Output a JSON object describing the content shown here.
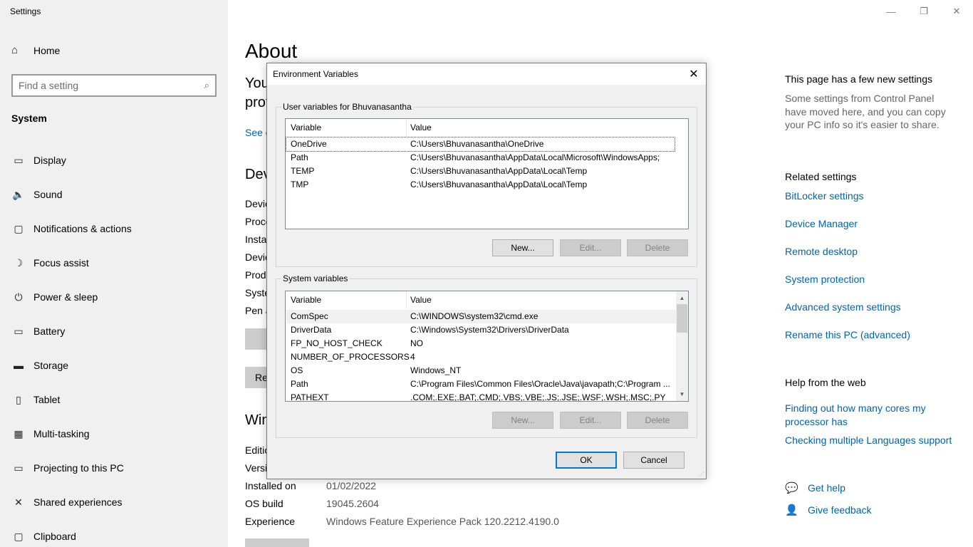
{
  "window": {
    "title": "Settings",
    "minimize": "—",
    "restore": "❐",
    "close": "✕"
  },
  "sidebar": {
    "home": "Home",
    "search_placeholder": "Find a setting",
    "section": "System",
    "items": [
      {
        "label": "Display",
        "icon": "display-icon",
        "glyph": "▭"
      },
      {
        "label": "Sound",
        "icon": "sound-icon",
        "glyph": "🔈"
      },
      {
        "label": "Notifications & actions",
        "icon": "notifications-icon",
        "glyph": "▢"
      },
      {
        "label": "Focus assist",
        "icon": "moon-icon",
        "glyph": "☽"
      },
      {
        "label": "Power & sleep",
        "icon": "power-icon",
        "glyph": "⏻"
      },
      {
        "label": "Battery",
        "icon": "battery-icon",
        "glyph": "▭"
      },
      {
        "label": "Storage",
        "icon": "storage-icon",
        "glyph": "▬"
      },
      {
        "label": "Tablet",
        "icon": "tablet-icon",
        "glyph": "▯"
      },
      {
        "label": "Multi-tasking",
        "icon": "multitasking-icon",
        "glyph": "▦"
      },
      {
        "label": "Projecting to this PC",
        "icon": "projecting-icon",
        "glyph": "▭"
      },
      {
        "label": "Shared experiences",
        "icon": "shared-icon",
        "glyph": "✕"
      },
      {
        "label": "Clipboard",
        "icon": "clipboard-icon",
        "glyph": "▢"
      }
    ]
  },
  "main": {
    "title": "About",
    "fragments": {
      "you": "You",
      "pro": "prot",
      "see": "See d",
      "dev": "Dev",
      "devi": "Devic",
      "proc": "Proce",
      "inst": "Instal",
      "devi2": "Devic",
      "prod": "Produ",
      "syst": "Syste",
      "pen": "Pen a",
      "re": "Re",
      "win": "Win",
      "edit": "Editio",
      "vers": "Versi"
    },
    "specs": [
      {
        "key": "Installed on",
        "value": "01/02/2022"
      },
      {
        "key": "OS build",
        "value": "19045.2604"
      },
      {
        "key": "Experience",
        "value": "Windows Feature Experience Pack 120.2212.4190.0"
      }
    ]
  },
  "right": {
    "new_settings_title": "This page has a few new settings",
    "new_settings_desc": "Some settings from Control Panel have moved here, and you can copy your PC info so it's easier to share.",
    "related_title": "Related settings",
    "related_links": [
      "BitLocker settings",
      "Device Manager",
      "Remote desktop",
      "System protection",
      "Advanced system settings",
      "Rename this PC (advanced)"
    ],
    "web_title": "Help from the web",
    "web_links": [
      "Finding out how many cores my processor has",
      "Checking multiple Languages support"
    ],
    "get_help": "Get help",
    "give_feedback": "Give feedback"
  },
  "dialog": {
    "title": "Environment Variables",
    "close": "✕",
    "user_group": "User variables for Bhuvanasantha",
    "system_group": "System variables",
    "col_variable": "Variable",
    "col_value": "Value",
    "user_vars": [
      {
        "name": "OneDrive",
        "value": "C:\\Users\\Bhuvanasantha\\OneDrive"
      },
      {
        "name": "Path",
        "value": "C:\\Users\\Bhuvanasantha\\AppData\\Local\\Microsoft\\WindowsApps;"
      },
      {
        "name": "TEMP",
        "value": "C:\\Users\\Bhuvanasantha\\AppData\\Local\\Temp"
      },
      {
        "name": "TMP",
        "value": "C:\\Users\\Bhuvanasantha\\AppData\\Local\\Temp"
      }
    ],
    "system_vars": [
      {
        "name": "ComSpec",
        "value": "C:\\WINDOWS\\system32\\cmd.exe"
      },
      {
        "name": "DriverData",
        "value": "C:\\Windows\\System32\\Drivers\\DriverData"
      },
      {
        "name": "FP_NO_HOST_CHECK",
        "value": "NO"
      },
      {
        "name": "NUMBER_OF_PROCESSORS",
        "value": "4"
      },
      {
        "name": "OS",
        "value": "Windows_NT"
      },
      {
        "name": "Path",
        "value": "C:\\Program Files\\Common Files\\Oracle\\Java\\javapath;C:\\Program ..."
      },
      {
        "name": "PATHEXT",
        "value": ".COM;.EXE;.BAT;.CMD;.VBS;.VBE;.JS;.JSE;.WSF;.WSH;.MSC;.PY"
      }
    ],
    "btn_new": "New...",
    "btn_edit": "Edit...",
    "btn_delete": "Delete",
    "btn_ok": "OK",
    "btn_cancel": "Cancel"
  }
}
